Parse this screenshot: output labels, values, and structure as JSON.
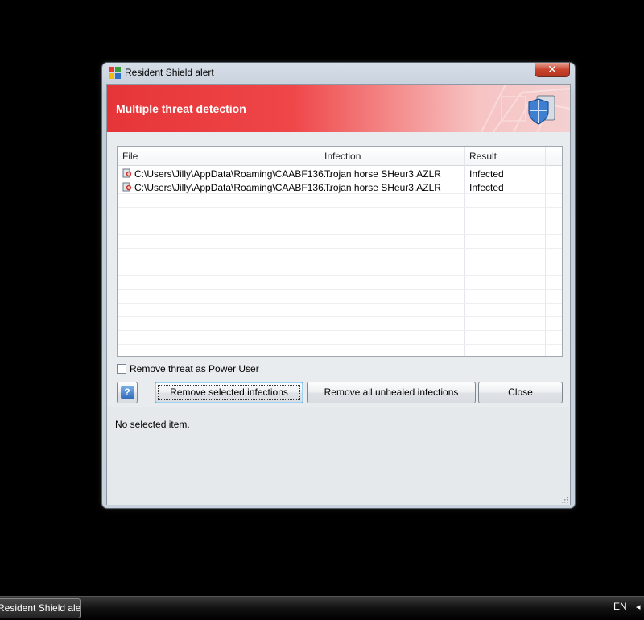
{
  "window": {
    "title": "Resident Shield alert",
    "close_glyph": "✕",
    "banner_title": "Multiple threat detection",
    "accent_color": "#e63538"
  },
  "table": {
    "columns": [
      "File",
      "Infection",
      "Result"
    ],
    "rows": [
      {
        "file": "C:\\Users\\Jilly\\AppData\\Roaming\\CAABF136...",
        "infection": "Trojan horse SHeur3.AZLR",
        "result": "Infected"
      },
      {
        "file": "C:\\Users\\Jilly\\AppData\\Roaming\\CAABF136...",
        "infection": "Trojan horse SHeur3.AZLR",
        "result": "Infected"
      }
    ]
  },
  "options": {
    "power_user_label": "Remove threat as Power User",
    "power_user_checked": false
  },
  "buttons": {
    "help_glyph": "?",
    "remove_selected": "Remove selected infections",
    "remove_all": "Remove all unhealed infections",
    "close": "Close"
  },
  "status": {
    "text": "No selected item."
  },
  "taskbar": {
    "item_label": "Resident Shield alert",
    "language": "EN",
    "tray_arrow": "◂"
  }
}
